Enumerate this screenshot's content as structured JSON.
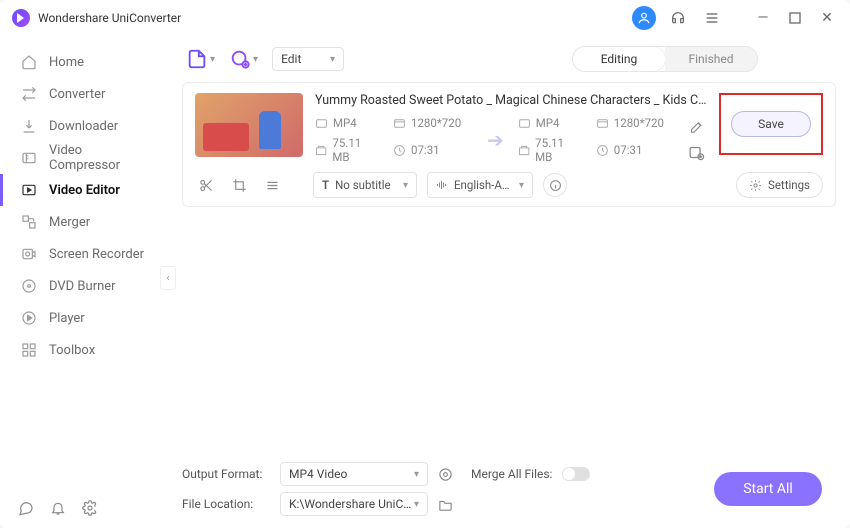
{
  "app": {
    "name": "Wondershare UniConverter"
  },
  "nav": {
    "items": [
      {
        "label": "Home",
        "icon": "home"
      },
      {
        "label": "Converter",
        "icon": "converter"
      },
      {
        "label": "Downloader",
        "icon": "downloader"
      },
      {
        "label": "Video Compressor",
        "icon": "compressor"
      },
      {
        "label": "Video Editor",
        "icon": "editor",
        "active": true
      },
      {
        "label": "Merger",
        "icon": "merger"
      },
      {
        "label": "Screen Recorder",
        "icon": "recorder"
      },
      {
        "label": "DVD Burner",
        "icon": "dvd"
      },
      {
        "label": "Player",
        "icon": "player"
      },
      {
        "label": "Toolbox",
        "icon": "toolbox"
      }
    ]
  },
  "toolbar": {
    "edit_label": "Edit",
    "tabs": {
      "editing": "Editing",
      "finished": "Finished",
      "active": "editing"
    }
  },
  "file": {
    "name": "Yummy Roasted Sweet Potato _ Magical Chinese Characters _ Kids Cartoon _ B...",
    "src": {
      "format": "MP4",
      "resolution": "1280*720",
      "size": "75.11 MB",
      "duration": "07:31"
    },
    "dst": {
      "format": "MP4",
      "resolution": "1280*720",
      "size": "75.11 MB",
      "duration": "07:31"
    },
    "subtitle": "No subtitle",
    "language": "English-Advan...",
    "settings_label": "Settings",
    "save_label": "Save"
  },
  "footer": {
    "output_format_label": "Output Format:",
    "output_format_value": "MP4 Video",
    "file_location_label": "File Location:",
    "file_location_value": "K:\\Wondershare UniConverter",
    "merge_label": "Merge All Files:",
    "start_all_label": "Start All"
  }
}
